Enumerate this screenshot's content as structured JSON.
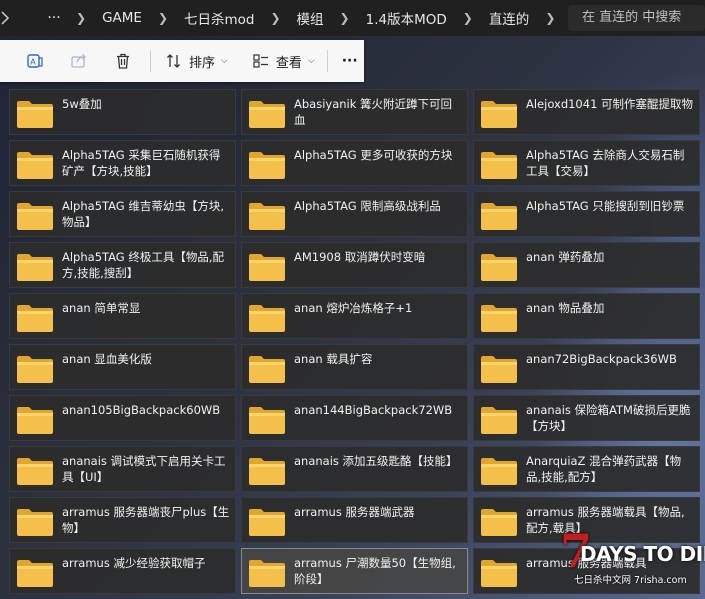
{
  "address_bar": {
    "overflow": "···",
    "crumbs": [
      "GAME",
      "七日杀mod",
      "模组",
      "1.4版本MOD",
      "直连的"
    ],
    "search_placeholder": "在 直连的 中搜索"
  },
  "command_bar": {
    "sort_label": "排序",
    "view_label": "查看",
    "more_label": "···"
  },
  "icons": {
    "translate": "translate-icon",
    "share": "share-icon",
    "delete": "trash-icon",
    "sort": "sort-icon",
    "view": "view-icon",
    "folder": "folder-icon"
  },
  "colors": {
    "folder_body": "#f5c04a",
    "folder_tab": "#e0a62d",
    "tile_bg": "#2c2c2c",
    "watermark_red": "#c41e1e"
  },
  "folders": [
    {
      "name": "5w叠加",
      "selected": false
    },
    {
      "name": "Abasiyanik 篝火附近蹲下可回血",
      "selected": false
    },
    {
      "name": "Alejoxd1041 可制作塞醌提取物",
      "selected": false
    },
    {
      "name": "Alpha5TAG 采集巨石随机获得矿产【方块,技能】",
      "selected": false
    },
    {
      "name": "Alpha5TAG 更多可收获的方块",
      "selected": false
    },
    {
      "name": "Alpha5TAG 去除商人交易石制工具【交易】",
      "selected": false
    },
    {
      "name": "Alpha5TAG 维吉蒂幼虫【方块,物品】",
      "selected": false
    },
    {
      "name": "Alpha5TAG 限制高级战利品",
      "selected": false
    },
    {
      "name": "Alpha5TAG 只能搜刮到旧钞票",
      "selected": false
    },
    {
      "name": "Alpha5TAG 终极工具【物品,配方,技能,搜刮】",
      "selected": false
    },
    {
      "name": "AM1908 取消蹲伏时变暗",
      "selected": false
    },
    {
      "name": "anan 弹药叠加",
      "selected": false
    },
    {
      "name": "anan 简单常显",
      "selected": false
    },
    {
      "name": "anan 熔炉冶炼格子+1",
      "selected": false
    },
    {
      "name": "anan 物品叠加",
      "selected": false
    },
    {
      "name": "anan 显血美化版",
      "selected": false
    },
    {
      "name": "anan 载具扩容",
      "selected": false
    },
    {
      "name": "anan72BigBackpack36WB",
      "selected": false
    },
    {
      "name": "anan105BigBackpack60WB",
      "selected": false
    },
    {
      "name": "anan144BigBackpack72WB",
      "selected": false
    },
    {
      "name": "ananais 保险箱ATM破损后更脆【方块】",
      "selected": false
    },
    {
      "name": "ananais 调试模式下启用关卡工具【UI】",
      "selected": false
    },
    {
      "name": "ananais 添加五级匙酪【技能】",
      "selected": false
    },
    {
      "name": "AnarquiaZ 混合弹药武器【物品,技能,配方】",
      "selected": false
    },
    {
      "name": "arramus 服务器端丧尸plus【生物】",
      "selected": false
    },
    {
      "name": "arramus 服务器端武器",
      "selected": false
    },
    {
      "name": "arramus 服务器端载具【物品,配方,载具】",
      "selected": false
    },
    {
      "name": "arramus 减少经验获取帽子",
      "selected": false
    },
    {
      "name": "arramus 尸潮数量50【生物组,阶段】",
      "selected": true
    },
    {
      "name": "arramus 服务器端载具",
      "selected": false
    }
  ],
  "watermark": {
    "seven": "7",
    "title": "DAYS TO DIE",
    "subtitle": "七日杀中文网 7risha.com"
  }
}
